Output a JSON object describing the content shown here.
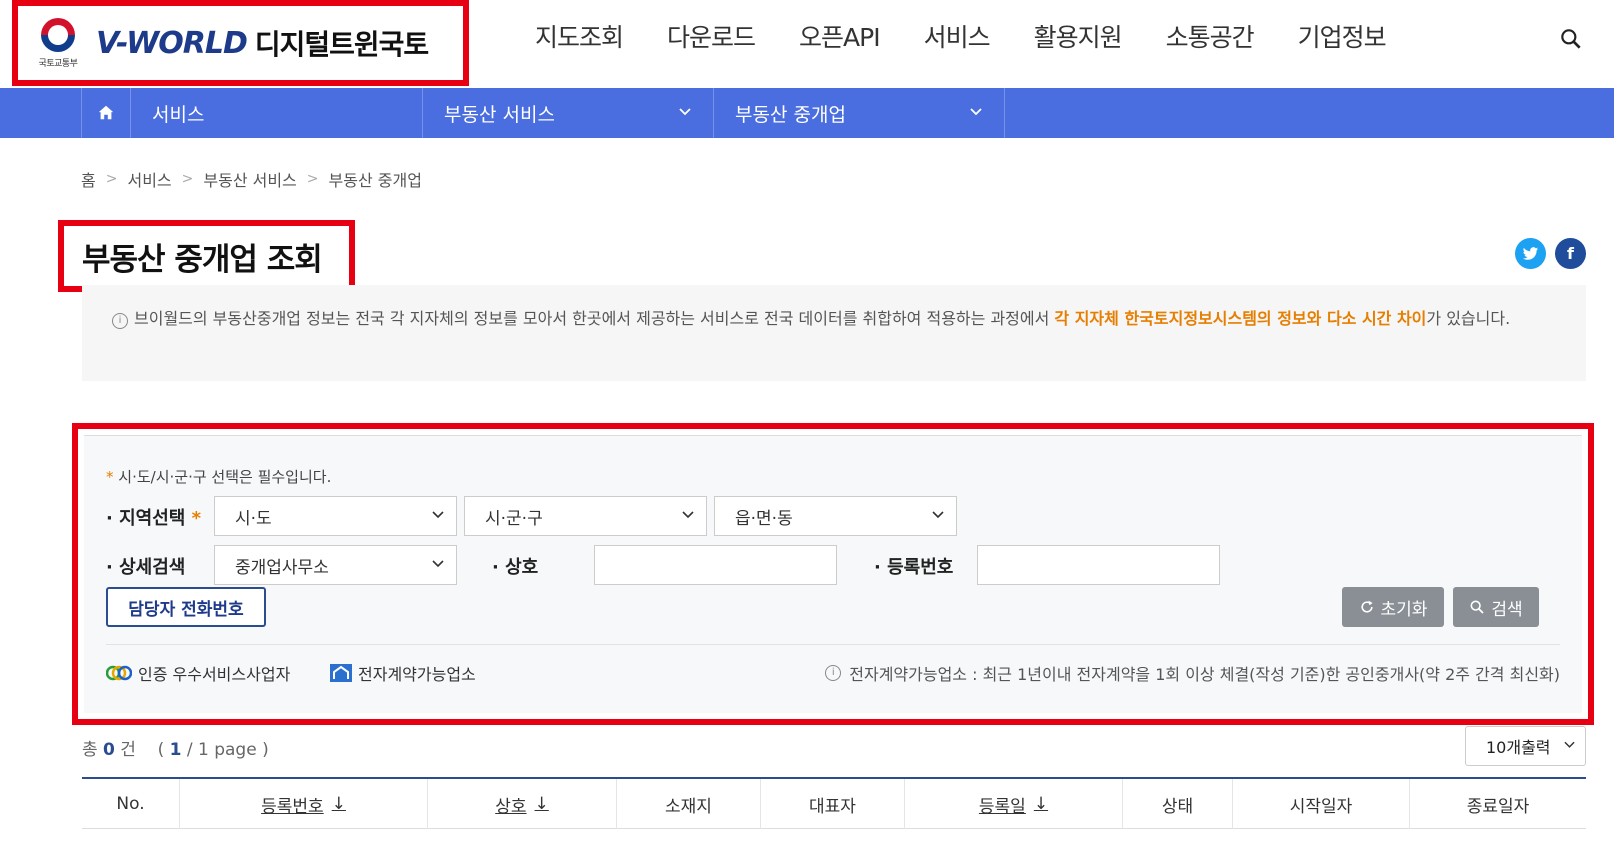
{
  "header": {
    "ministry_label": "국토교통부",
    "brand": "V-WORLD",
    "brand_sub": "디지털트윈국토",
    "gnb": [
      "지도조회",
      "다운로드",
      "오픈API",
      "서비스",
      "활용지원",
      "소통공간",
      "기업정보"
    ]
  },
  "subnav": {
    "items": [
      "서비스",
      "부동산 서비스",
      "부동산 중개업"
    ]
  },
  "breadcrumb": [
    "홈",
    "서비스",
    "부동산 서비스",
    "부동산 중개업"
  ],
  "page": {
    "title": "부동산 중개업 조회"
  },
  "sns": {
    "twitter": "t",
    "facebook": "f"
  },
  "notice": {
    "text_normal": "브이월드의 부동산중개업 정보는 전국 각 지자체의 정보를 모아서 한곳에서 제공하는 서비스로 전국 데이터를 취합하여 적용하는 과정에서 ",
    "text_highlight": "각 지자체 한국토지정보시스템의 정보와 다소 시간 차이",
    "text_tail": "가 있습니다."
  },
  "search": {
    "required_note": "시·도/시·군·구 선택은 필수입니다.",
    "region_label": "지역선택",
    "sido": "시·도",
    "sigungu": "시·군·구",
    "emd": "읍·면·동",
    "detail_label": "상세검색",
    "detail_select": "중개업사무소",
    "name_label": "상호",
    "regno_label": "등록번호",
    "name_value": "",
    "regno_value": "",
    "phone_button": "담당자 전화번호",
    "reset_button": "초기화",
    "search_button": "검색",
    "legend_certified": "인증 우수서비스사업자",
    "legend_econtract": "전자계약가능업소",
    "econtract_note": "전자계약가능업소 : 최근 1년이내 전자계약을 1회 이상 체결(작성 기준)한 공인중개사(약 2주 간격 최신화)"
  },
  "results": {
    "total_prefix": "총",
    "total_count": "0",
    "total_suffix": "건",
    "page_open": "(",
    "page_current": "1",
    "page_slash": "/",
    "page_total": "1 page",
    "page_close": ")",
    "page_size": "10개출력",
    "columns": [
      "No.",
      "등록번호",
      "상호",
      "소재지",
      "대표자",
      "등록일",
      "상태",
      "시작일자",
      "종료일자"
    ]
  },
  "colors": {
    "brand_blue": "#4a6ee0",
    "highlight_border": "#e60012",
    "accent_orange": "#e67e00",
    "navy": "#2a4d8f"
  }
}
